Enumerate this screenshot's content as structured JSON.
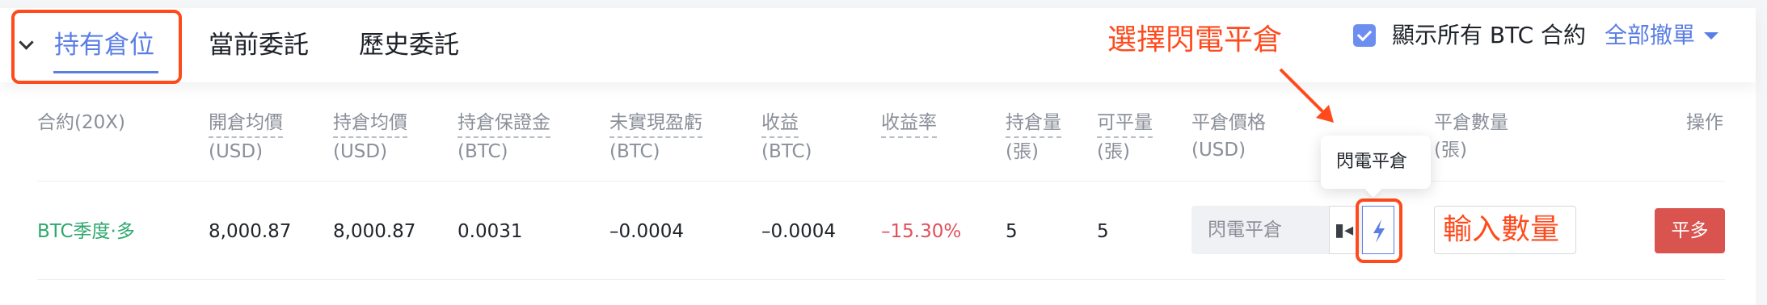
{
  "tabs": [
    {
      "label": "持有倉位"
    },
    {
      "label": "當前委託"
    },
    {
      "label": "歷史委託"
    }
  ],
  "annotation": {
    "label": "選擇閃電平倉",
    "color": "#ff4a1c"
  },
  "toolbar": {
    "show_all_label": "顯示所有 BTC 合約",
    "show_all_checked": true,
    "cancel_all_label": "全部撤單"
  },
  "columns": [
    {
      "line1": "合約(20X)",
      "line2": ""
    },
    {
      "line1": "開倉均價",
      "line2": "(USD)"
    },
    {
      "line1": "持倉均價",
      "line2": "(USD)"
    },
    {
      "line1": "持倉保證金",
      "line2": "(BTC)"
    },
    {
      "line1": "未實現盈虧",
      "line2": "(BTC)"
    },
    {
      "line1": "收益",
      "line2": "(BTC)"
    },
    {
      "line1": "收益率",
      "line2": ""
    },
    {
      "line1": "持倉量",
      "line2": "(張)"
    },
    {
      "line1": "可平量",
      "line2": "(張)"
    },
    {
      "line1": "平倉價格",
      "line2": "(USD)"
    },
    {
      "line1": "平倉數量",
      "line2": "(張)"
    },
    {
      "line1": "操作",
      "line2": ""
    }
  ],
  "row": {
    "contract": "BTC季度·多",
    "open_avg_price": "8,000.87",
    "hold_avg_price": "8,000.87",
    "margin": "0.0031",
    "unrealized_pnl": "–0.0004",
    "pnl": "–0.0004",
    "pnl_rate": "–15.30%",
    "position": "5",
    "closable": "5",
    "close_price_placeholder": "閃電平倉",
    "close_qty_placeholder": "輸入數量",
    "action_label": "平多"
  },
  "tooltip": {
    "text": "閃電平倉"
  },
  "colors": {
    "accent": "#5b7ee5",
    "long_green": "#2ea86e",
    "loss_red": "#e0515a",
    "annotation_red": "#ff4a1c",
    "action_button": "#d9534f"
  },
  "icons": {
    "tab_toggle": "chevron-down-icon",
    "checkbox": "checkmark-icon",
    "dropdown": "caret-down-icon",
    "price_side": "bars-toggle-icon",
    "flash": "lightning-bolt-icon"
  }
}
